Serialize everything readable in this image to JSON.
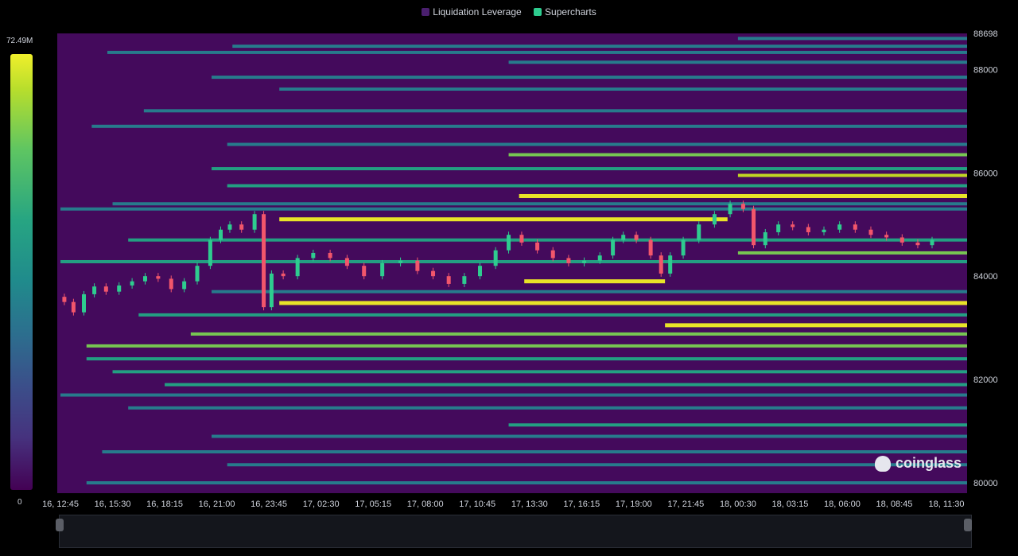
{
  "legend": {
    "items": [
      {
        "label": "Liquidation Leverage",
        "color": "#4a1f6e"
      },
      {
        "label": "Supercharts",
        "color": "#2ecc8f"
      }
    ]
  },
  "color_scale": {
    "max_label": "72.49M",
    "min_label": "0"
  },
  "watermark": "coinglass",
  "colors": {
    "background": "#440a5c",
    "candle_up": "#2ecc8f",
    "candle_down": "#f2566b",
    "navigator_line": "#4d6a9a"
  },
  "chart_data": {
    "type": "heatmap",
    "title": "",
    "y_axis": {
      "ticks": [
        80000,
        82000,
        84000,
        86000,
        88000
      ],
      "top_label": "88698",
      "range": [
        79800,
        88698
      ],
      "position": "right"
    },
    "x_axis": {
      "ticks": [
        "16, 12:45",
        "16, 15:30",
        "16, 18:15",
        "16, 21:00",
        "16, 23:45",
        "17, 02:30",
        "17, 05:15",
        "17, 08:00",
        "17, 10:45",
        "17, 13:30",
        "17, 16:15",
        "17, 19:00",
        "17, 21:45",
        "18, 00:30",
        "18, 03:15",
        "18, 06:00",
        "18, 08:45",
        "18, 11:30"
      ]
    },
    "heatmap_bands": [
      {
        "price": 88600,
        "start_tick": 13.0,
        "intensity": 0.35
      },
      {
        "price": 88450,
        "start_tick": 3.3,
        "intensity": 0.3
      },
      {
        "price": 88330,
        "start_tick": 0.9,
        "intensity": 0.25
      },
      {
        "price": 88140,
        "start_tick": 8.6,
        "intensity": 0.4
      },
      {
        "price": 87850,
        "start_tick": 2.9,
        "intensity": 0.3
      },
      {
        "price": 87620,
        "start_tick": 4.2,
        "intensity": 0.35
      },
      {
        "price": 87200,
        "start_tick": 1.6,
        "intensity": 0.3
      },
      {
        "price": 86900,
        "start_tick": 0.6,
        "intensity": 0.35
      },
      {
        "price": 86550,
        "start_tick": 3.2,
        "intensity": 0.35
      },
      {
        "price": 86350,
        "start_tick": 8.6,
        "intensity": 0.6
      },
      {
        "price": 86080,
        "start_tick": 2.9,
        "intensity": 0.45
      },
      {
        "price": 85950,
        "start_tick": 13.0,
        "intensity": 0.75
      },
      {
        "price": 85750,
        "start_tick": 3.2,
        "intensity": 0.55
      },
      {
        "price": 85550,
        "start_tick": 8.8,
        "intensity": 1.0
      },
      {
        "price": 85400,
        "start_tick": 1.0,
        "intensity": 0.4
      },
      {
        "price": 85300,
        "start_tick": 0.0,
        "intensity": 0.35
      },
      {
        "price": 85100,
        "start_tick": 4.2,
        "intensity": 0.95,
        "end_tick": 12.8
      },
      {
        "price": 84700,
        "start_tick": 1.3,
        "intensity": 0.45
      },
      {
        "price": 84450,
        "start_tick": 13.0,
        "intensity": 0.6
      },
      {
        "price": 84280,
        "start_tick": 0.0,
        "intensity": 0.55
      },
      {
        "price": 83900,
        "start_tick": 8.9,
        "intensity": 0.95,
        "end_tick": 11.6
      },
      {
        "price": 83700,
        "start_tick": 2.9,
        "intensity": 0.35
      },
      {
        "price": 83480,
        "start_tick": 4.2,
        "intensity": 1.0
      },
      {
        "price": 83250,
        "start_tick": 1.5,
        "intensity": 0.45
      },
      {
        "price": 83050,
        "start_tick": 11.6,
        "intensity": 0.95
      },
      {
        "price": 82880,
        "start_tick": 2.5,
        "intensity": 0.6
      },
      {
        "price": 82650,
        "start_tick": 0.5,
        "intensity": 0.65
      },
      {
        "price": 82400,
        "start_tick": 0.5,
        "intensity": 0.55
      },
      {
        "price": 82150,
        "start_tick": 1.0,
        "intensity": 0.5
      },
      {
        "price": 81900,
        "start_tick": 2.0,
        "intensity": 0.45
      },
      {
        "price": 81700,
        "start_tick": 0.0,
        "intensity": 0.35
      },
      {
        "price": 81450,
        "start_tick": 1.3,
        "intensity": 0.4
      },
      {
        "price": 81120,
        "start_tick": 8.6,
        "intensity": 0.45
      },
      {
        "price": 80900,
        "start_tick": 2.9,
        "intensity": 0.4
      },
      {
        "price": 80600,
        "start_tick": 0.8,
        "intensity": 0.35
      },
      {
        "price": 80350,
        "start_tick": 3.2,
        "intensity": 0.4
      },
      {
        "price": 80000,
        "start_tick": 0.5,
        "intensity": 0.3
      }
    ],
    "price_series": [
      [
        0.0,
        83600
      ],
      [
        0.15,
        83500
      ],
      [
        0.35,
        83300
      ],
      [
        0.55,
        83650
      ],
      [
        0.75,
        83800
      ],
      [
        1.0,
        83700
      ],
      [
        1.25,
        83820
      ],
      [
        1.5,
        83900
      ],
      [
        1.75,
        84000
      ],
      [
        2.0,
        83950
      ],
      [
        2.25,
        83750
      ],
      [
        2.5,
        83900
      ],
      [
        2.75,
        84200
      ],
      [
        3.0,
        84700
      ],
      [
        3.15,
        84900
      ],
      [
        3.35,
        85000
      ],
      [
        3.6,
        84900
      ],
      [
        3.85,
        85200
      ],
      [
        3.95,
        83400
      ],
      [
        4.15,
        84050
      ],
      [
        4.4,
        84000
      ],
      [
        4.7,
        84350
      ],
      [
        5.0,
        84450
      ],
      [
        5.35,
        84350
      ],
      [
        5.65,
        84200
      ],
      [
        6.0,
        84000
      ],
      [
        6.35,
        84250
      ],
      [
        6.7,
        84300
      ],
      [
        7.0,
        84100
      ],
      [
        7.3,
        84000
      ],
      [
        7.6,
        83850
      ],
      [
        7.9,
        84000
      ],
      [
        8.2,
        84200
      ],
      [
        8.5,
        84500
      ],
      [
        8.7,
        84800
      ],
      [
        9.0,
        84650
      ],
      [
        9.3,
        84500
      ],
      [
        9.6,
        84350
      ],
      [
        9.9,
        84250
      ],
      [
        10.2,
        84300
      ],
      [
        10.5,
        84400
      ],
      [
        10.7,
        84700
      ],
      [
        10.9,
        84800
      ],
      [
        11.2,
        84700
      ],
      [
        11.45,
        84400
      ],
      [
        11.6,
        84050
      ],
      [
        11.8,
        84400
      ],
      [
        12.1,
        84700
      ],
      [
        12.4,
        85000
      ],
      [
        12.7,
        85200
      ],
      [
        13.0,
        85400
      ],
      [
        13.2,
        85300
      ],
      [
        13.4,
        84600
      ],
      [
        13.65,
        84850
      ],
      [
        13.9,
        85000
      ],
      [
        14.2,
        84950
      ],
      [
        14.5,
        84850
      ],
      [
        14.8,
        84900
      ],
      [
        15.1,
        85000
      ],
      [
        15.4,
        84900
      ],
      [
        15.7,
        84800
      ],
      [
        16.0,
        84750
      ],
      [
        16.3,
        84650
      ],
      [
        16.6,
        84600
      ],
      [
        16.85,
        84700
      ]
    ],
    "navigator": {
      "type": "area",
      "series": "price"
    }
  }
}
